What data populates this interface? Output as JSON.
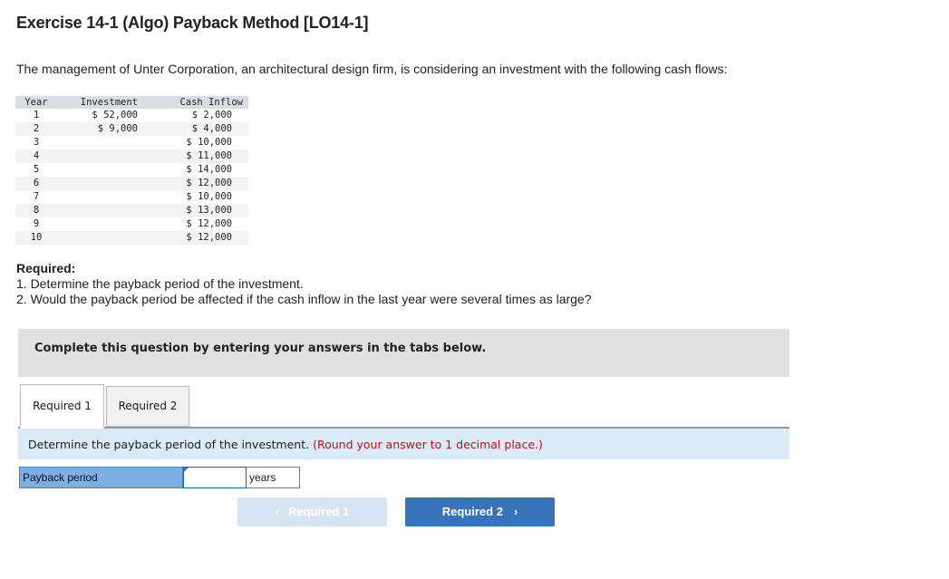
{
  "title": "Exercise 14-1 (Algo) Payback Method [LO14-1]",
  "intro": "The management of Unter Corporation, an architectural design firm, is considering an investment with the following cash flows:",
  "cash_flow_table": {
    "headers": [
      "Year",
      "Investment",
      "Cash Inflow"
    ],
    "rows": [
      {
        "year": "1",
        "investment": "$ 52,000",
        "cash_inflow": "$ 2,000"
      },
      {
        "year": "2",
        "investment": "$ 9,000",
        "cash_inflow": "$ 4,000"
      },
      {
        "year": "3",
        "investment": "",
        "cash_inflow": "$ 10,000"
      },
      {
        "year": "4",
        "investment": "",
        "cash_inflow": "$ 11,000"
      },
      {
        "year": "5",
        "investment": "",
        "cash_inflow": "$ 14,000"
      },
      {
        "year": "6",
        "investment": "",
        "cash_inflow": "$ 12,000"
      },
      {
        "year": "7",
        "investment": "",
        "cash_inflow": "$ 10,000"
      },
      {
        "year": "8",
        "investment": "",
        "cash_inflow": "$ 13,000"
      },
      {
        "year": "9",
        "investment": "",
        "cash_inflow": "$ 12,000"
      },
      {
        "year": "10",
        "investment": "",
        "cash_inflow": "$ 12,000"
      }
    ]
  },
  "required": {
    "heading": "Required:",
    "items": [
      "1. Determine the payback period of the investment.",
      "2. Would the payback period be affected if the cash inflow in the last year were several times as large?"
    ]
  },
  "instruction_banner": "Complete this question by entering your answers in the tabs below.",
  "tabs": [
    {
      "label": "Required 1",
      "active": true
    },
    {
      "label": "Required 2",
      "active": false
    }
  ],
  "prompt": {
    "text": "Determine the payback period of the investment.",
    "note": "(Round your answer to 1 decimal place.)"
  },
  "answer_row": {
    "label": "Payback period",
    "value": "",
    "unit": "years"
  },
  "navigation": {
    "prev_label": "Required 1",
    "next_label": "Required 2",
    "prev_icon": "chevron-left-icon",
    "next_icon": "chevron-right-icon"
  }
}
